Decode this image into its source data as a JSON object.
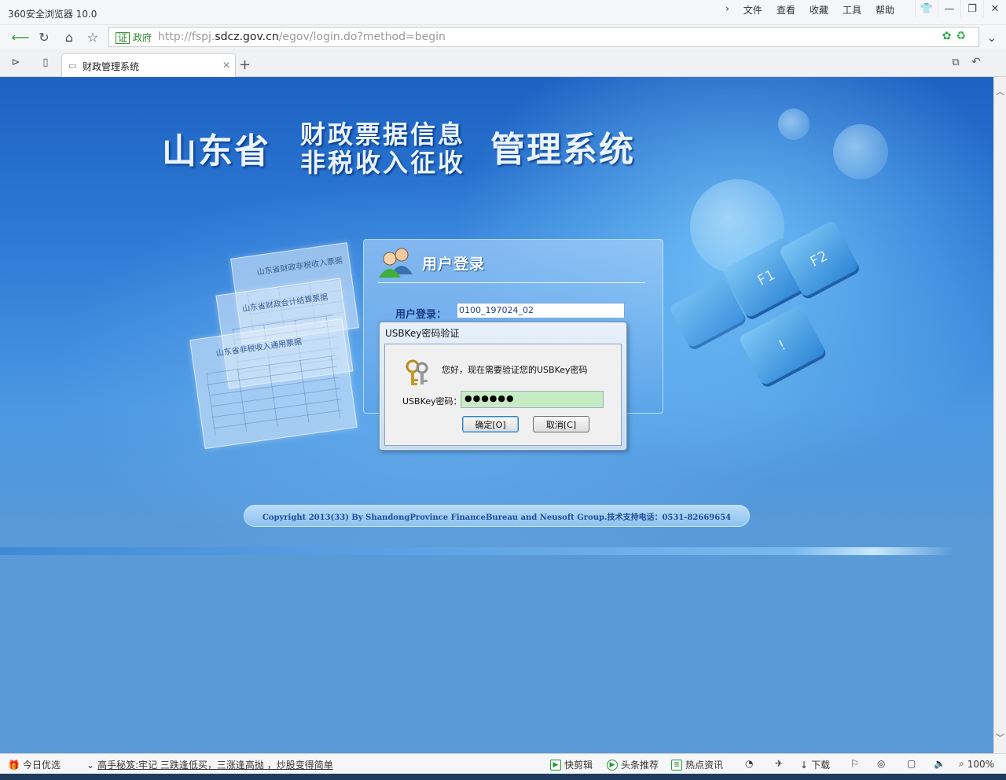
{
  "browser": {
    "app_title": "360安全浏览器 10.0",
    "menu": [
      "文件",
      "查看",
      "收藏",
      "工具",
      "帮助"
    ],
    "cert_badge": "证",
    "cert_label": "政府",
    "url_prefix": "http://fspj.",
    "url_host": "sdcz.gov.cn",
    "url_path": "/egov/login.do?method=begin",
    "tab_title": "财政管理系统"
  },
  "page": {
    "province": "山东省",
    "title_line1": "财政票据信息",
    "title_line2": "非税收入征收",
    "title_suffix": "管理系统",
    "login_title": "用户登录",
    "user_label": "用户登录：",
    "user_value": "0100_197024_02",
    "copyright": "Copyright 2013(33) By ShandongProvince FinanceBureau and Neusoft Group.技术支持电话：0531-82669654",
    "receipt_titles": [
      "山东省财政非税收入票据",
      "山东省财政会计结算票据",
      "山东省非税收入通用票据"
    ]
  },
  "dialog": {
    "title": "USBKey密码验证",
    "message": "您好，现在需要验证您的USBKey密码",
    "password_label": "USBKey密码：",
    "password_value": "●●●●●●",
    "ok_label": "确定[O]",
    "cancel_label": "取消[C]"
  },
  "status": {
    "today": "今日优选",
    "news": "高手秘笈:牢记 三跌逢低买，三涨逢高抛 ，炒股变得简单",
    "quick_edit": "快剪辑",
    "headlines": "头条推荐",
    "hot_news": "热点资讯",
    "download": "下载",
    "zoom": "100%"
  },
  "colors": {
    "page_blue": "#5a9ad7",
    "hero_dark": "#1e62c2",
    "password_fill": "#c7ecc3"
  }
}
